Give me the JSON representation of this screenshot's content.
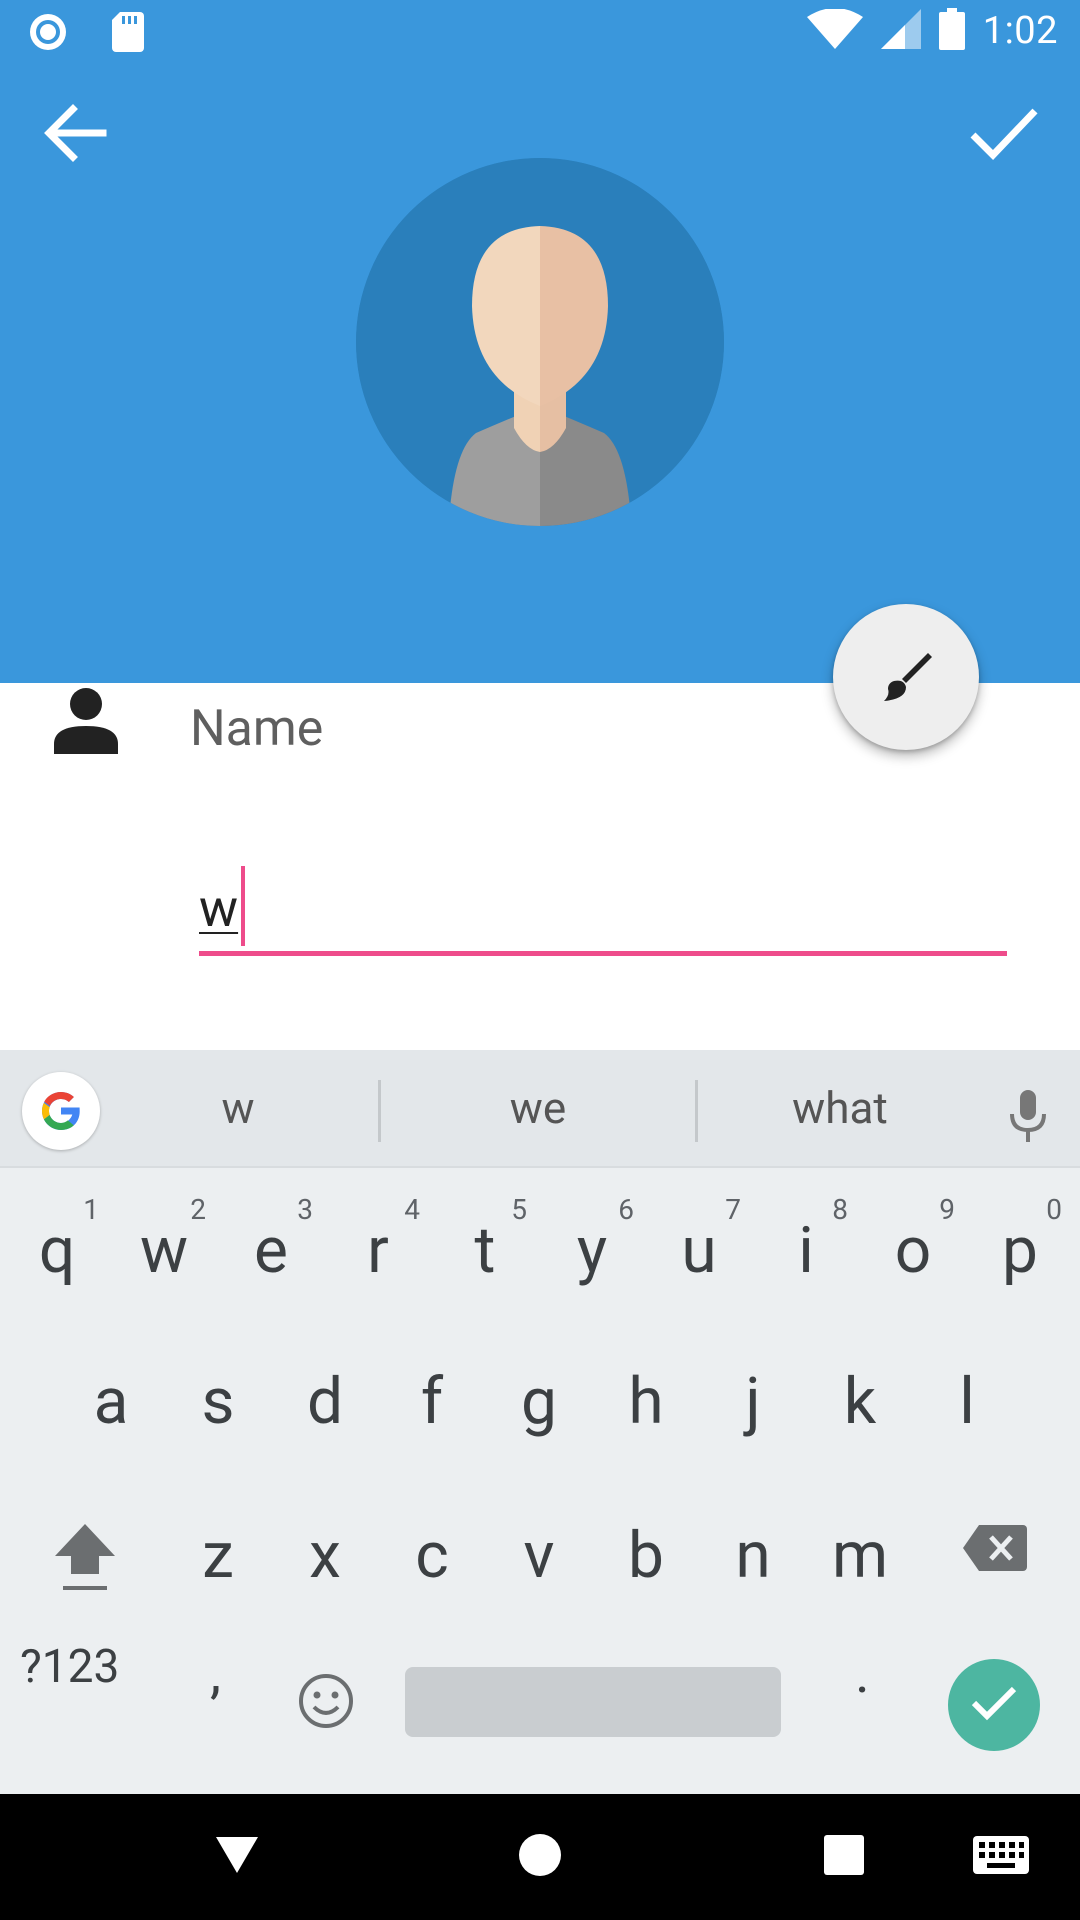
{
  "status_bar": {
    "time": "1:02",
    "icons": [
      "record-icon",
      "sd-card-icon",
      "wifi-icon",
      "signal-icon",
      "battery-icon"
    ]
  },
  "toolbar": {
    "back_icon": "arrow-back-icon",
    "confirm_icon": "check-icon"
  },
  "profile": {
    "avatar_icon": "default-avatar",
    "edit_fab_icon": "paintbrush-icon"
  },
  "form": {
    "name_label": "Name",
    "name_value": "w"
  },
  "keyboard": {
    "suggestions": [
      "w",
      "we",
      "what"
    ],
    "row1": [
      {
        "key": "q",
        "hint": "1"
      },
      {
        "key": "w",
        "hint": "2"
      },
      {
        "key": "e",
        "hint": "3"
      },
      {
        "key": "r",
        "hint": "4"
      },
      {
        "key": "t",
        "hint": "5"
      },
      {
        "key": "y",
        "hint": "6"
      },
      {
        "key": "u",
        "hint": "7"
      },
      {
        "key": "i",
        "hint": "8"
      },
      {
        "key": "o",
        "hint": "9"
      },
      {
        "key": "p",
        "hint": "0"
      }
    ],
    "row2": [
      "a",
      "s",
      "d",
      "f",
      "g",
      "h",
      "j",
      "k",
      "l"
    ],
    "row3": [
      "z",
      "x",
      "c",
      "v",
      "b",
      "n",
      "m"
    ],
    "symbols_label": "?123",
    "comma_label": ",",
    "period_label": "."
  },
  "colors": {
    "header": "#3a97dc",
    "accent": "#ee4c8b",
    "enter": "#4db6a1"
  }
}
